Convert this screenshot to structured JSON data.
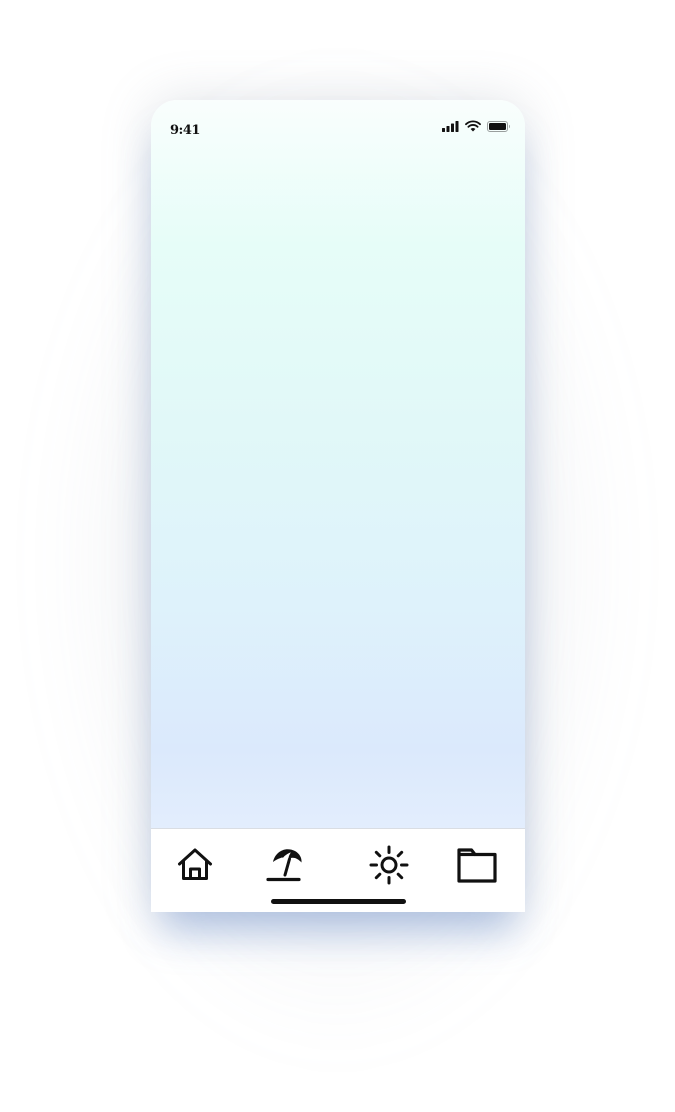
{
  "status_bar": {
    "time": "9:41",
    "icons": [
      "signal-icon",
      "wifi-icon",
      "battery-icon"
    ]
  },
  "content": {
    "gradient_colors": [
      "#f9fefd",
      "#e6fdf8",
      "#def2fb",
      "#dbe9fc",
      "#ebf2fe"
    ]
  },
  "bottom_nav": {
    "items": [
      {
        "icon": "home-icon",
        "selected": false
      },
      {
        "icon": "beach-umbrella-icon",
        "selected": true
      },
      {
        "icon": "sun-icon",
        "selected": false
      },
      {
        "icon": "folder-icon",
        "selected": false
      }
    ]
  }
}
